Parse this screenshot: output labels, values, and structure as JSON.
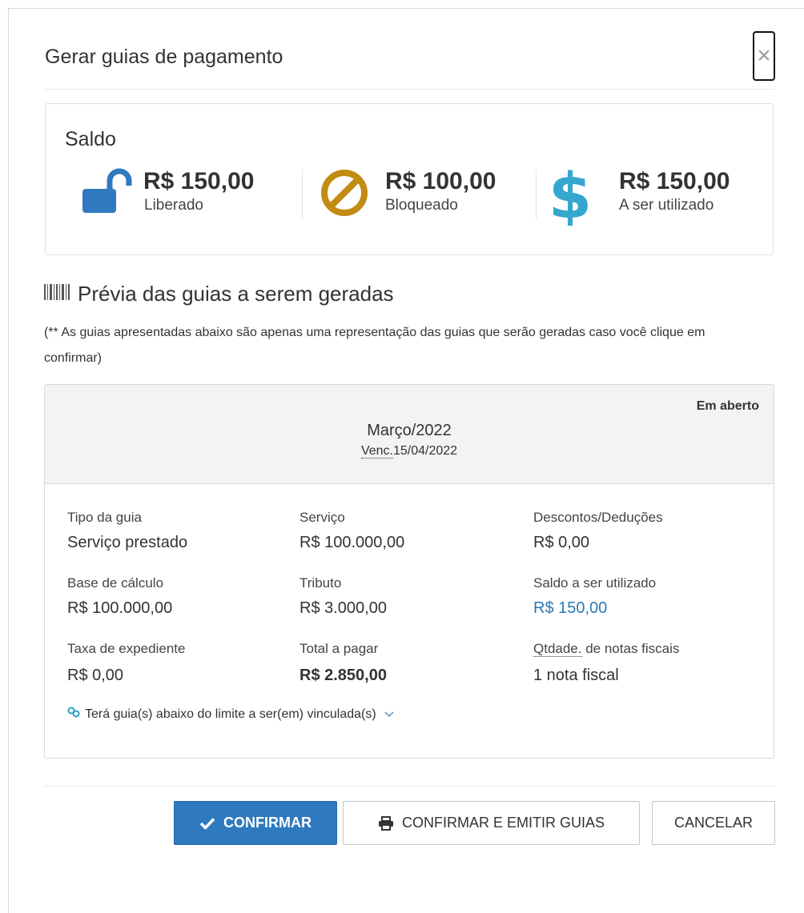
{
  "modal": {
    "title": "Gerar guias de pagamento",
    "close_label": "×"
  },
  "saldo": {
    "title": "Saldo",
    "items": [
      {
        "amount": "R$ 150,00",
        "label": "Liberado",
        "icon": "unlock-icon",
        "color": "#2f79be"
      },
      {
        "amount": "R$ 100,00",
        "label": "Bloqueado",
        "icon": "ban-icon",
        "color": "#c28b12"
      },
      {
        "amount": "R$ 150,00",
        "label": "A ser utilizado",
        "icon": "dollar-icon",
        "color": "#35a7cf"
      }
    ]
  },
  "preview": {
    "title": "Prévia das guias a serem geradas",
    "icon": "barcode-icon",
    "note": "(** As guias apresentadas abaixo são apenas uma representação das guias que serão geradas caso você clique em confirmar)"
  },
  "guia": {
    "status": "Em aberto",
    "period": "Março/2022",
    "venc_abbr": "Venc.",
    "venc_date": "15/04/2022",
    "fields": {
      "tipo": {
        "label": "Tipo da guia",
        "value": "Serviço prestado"
      },
      "servico": {
        "label": "Serviço",
        "value": "R$ 100.000,00"
      },
      "descontos": {
        "label": "Descontos/Deduções",
        "value": "R$ 0,00"
      },
      "base": {
        "label": "Base de cálculo",
        "value": "R$ 100.000,00"
      },
      "tributo": {
        "label": "Tributo",
        "value": "R$ 3.000,00"
      },
      "saldo_utilizado": {
        "label": "Saldo a ser utilizado",
        "value": "R$ 150,00"
      },
      "taxa": {
        "label": "Taxa de expediente",
        "value": "R$ 0,00"
      },
      "total": {
        "label": "Total a pagar",
        "value": "R$ 2.850,00"
      },
      "qtd_abbr": "Qtdade.",
      "qtd_label_rest": " de notas fiscais",
      "qtd_value": "1 nota fiscal"
    },
    "vinculadas": "Terá guia(s) abaixo do limite a ser(em) vinculada(s)"
  },
  "actions": {
    "confirm": "CONFIRMAR",
    "confirm_emit": "CONFIRMAR E EMITIR GUIAS",
    "cancel": "CANCELAR"
  },
  "colors": {
    "primary": "#2f79be",
    "accent_link": "#2a7ab5",
    "blocked": "#c28b12",
    "dollar": "#35a7cf"
  }
}
